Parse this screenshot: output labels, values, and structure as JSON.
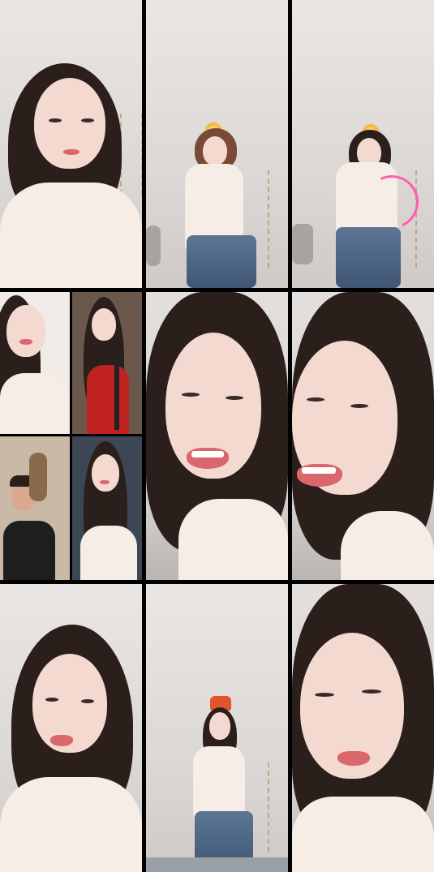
{
  "grid": {
    "tiles": [
      {
        "id": "tile-1",
        "scene": "close-up"
      },
      {
        "id": "tile-2",
        "scene": "dance"
      },
      {
        "id": "tile-3",
        "scene": "dance-effect"
      },
      {
        "id": "tile-4",
        "scene": "quad-split"
      },
      {
        "id": "tile-5",
        "scene": "close-up-smile"
      },
      {
        "id": "tile-6",
        "scene": "close-up-smile"
      },
      {
        "id": "tile-7",
        "scene": "close-up"
      },
      {
        "id": "tile-8",
        "scene": "dance-hat-effect"
      },
      {
        "id": "tile-9",
        "scene": "close-up"
      }
    ]
  },
  "colors": {
    "separator": "#000000",
    "shirt": "#f5ede6",
    "hair": "#2b1f1c",
    "jeans": "#4a6280",
    "effect_pink": "#ff5db1",
    "hat_orange": "#e0552b"
  }
}
